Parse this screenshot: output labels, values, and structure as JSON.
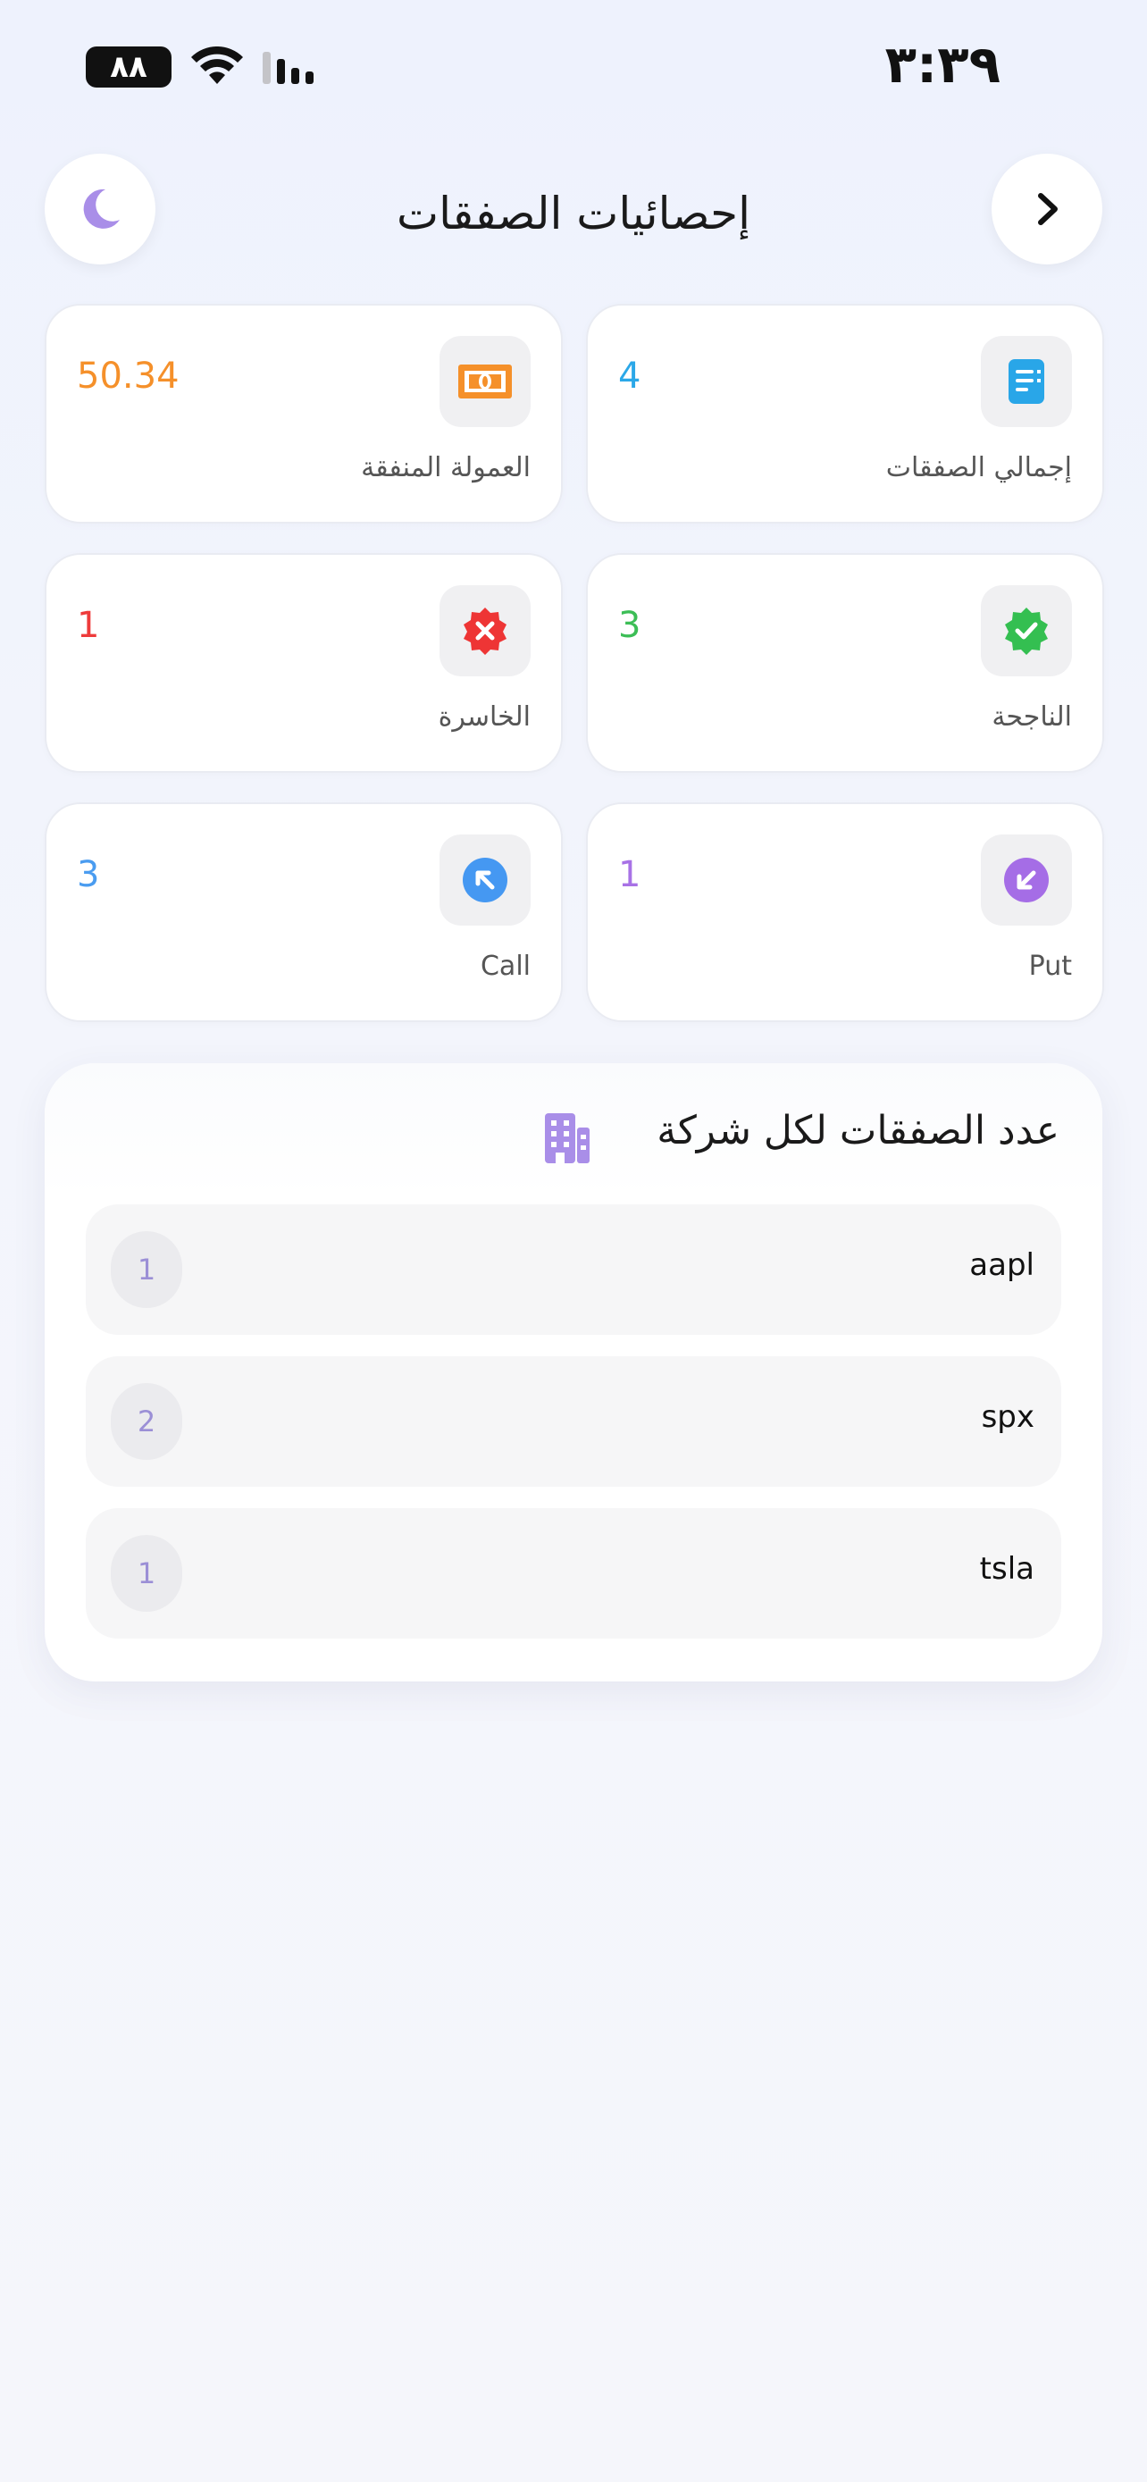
{
  "status_bar": {
    "time": "٣:٣٩",
    "battery": "٨٨"
  },
  "header": {
    "title": "إحصائيات الصفقات",
    "theme_icon": "moon-icon",
    "back_icon": "chevron-right-icon"
  },
  "stats": {
    "total_trades": {
      "label": "إجمالي الصفقات",
      "value": "4",
      "color": "#2ba8e8",
      "icon": "document-icon"
    },
    "commission": {
      "label": "العمولة المنفقة",
      "value": "50.34",
      "color": "#f5902a",
      "icon": "money-icon"
    },
    "winning": {
      "label": "الناجحة",
      "value": "3",
      "color": "#3cbe56",
      "icon": "check-badge-icon"
    },
    "losing": {
      "label": "الخاسرة",
      "value": "1",
      "color": "#ee3b3b",
      "icon": "x-badge-icon"
    },
    "put": {
      "label": "Put",
      "value": "1",
      "color": "#a872e6",
      "icon": "arrow-down-left-icon"
    },
    "call": {
      "label": "Call",
      "value": "3",
      "color": "#4a9cf0",
      "icon": "arrow-up-left-icon"
    }
  },
  "companies_panel": {
    "title": "عدد الصفقات لكل شركة",
    "icon": "building-icon",
    "rows": [
      {
        "name": "aapl",
        "count": "1"
      },
      {
        "name": "spx",
        "count": "2"
      },
      {
        "name": "tsla",
        "count": "1"
      }
    ]
  }
}
